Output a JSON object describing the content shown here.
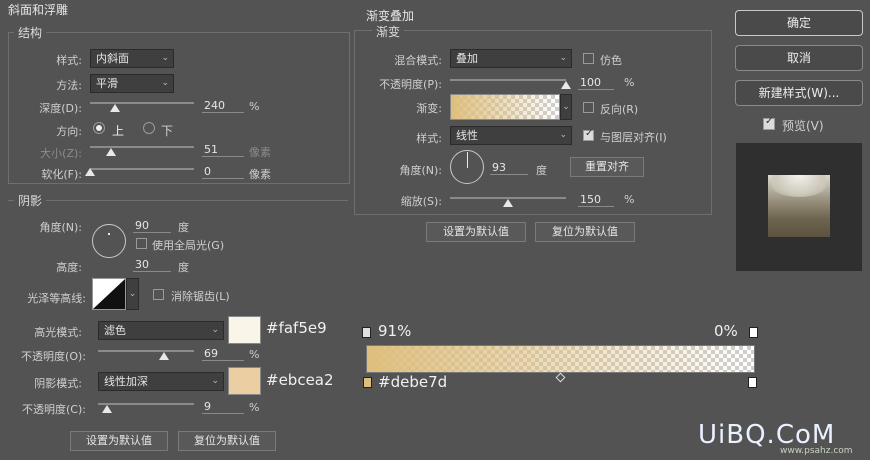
{
  "bevel": {
    "section_title": "斜面和浮雕",
    "structure_title": "结构",
    "style_label": "样式:",
    "style_value": "内斜面",
    "technique_label": "方法:",
    "technique_value": "平滑",
    "depth_label": "深度(D):",
    "depth_value": "240",
    "depth_unit": "%",
    "depth_level": 0.24,
    "direction_label": "方向:",
    "dir_up": "上",
    "dir_down": "下",
    "size_label": "大小(Z):",
    "size_value": "51",
    "size_unit": "像素",
    "size_level": 0.2,
    "soften_label": "软化(F):",
    "soften_value": "0",
    "soften_unit": "像素",
    "soften_level": 0.0
  },
  "shading": {
    "title": "阴影",
    "angle_label": "角度(N):",
    "angle_value": "90",
    "angle_unit": "度",
    "global_light_label": "使用全局光(G)",
    "altitude_label": "高度:",
    "altitude_value": "30",
    "altitude_unit": "度",
    "gloss_label": "光泽等高线:",
    "anti_alias_label": "消除锯齿(L)",
    "highlight_label": "高光模式:",
    "highlight_value": "滤色",
    "highlight_hex": "#faf5e9",
    "highlight_color": "#faf5e9",
    "hl_opacity_label": "不透明度(O):",
    "hl_opacity_value": "69",
    "hl_opacity_unit": "%",
    "hl_opacity_level": 0.69,
    "shadow_label": "阴影模式:",
    "shadow_value": "线性加深",
    "shadow_hex": "#ebcea2",
    "shadow_color": "#ebcea2",
    "sh_opacity_label": "不透明度(C):",
    "sh_opacity_value": "9",
    "sh_opacity_unit": "%",
    "sh_opacity_level": 0.09
  },
  "bottom_buttons": {
    "make_default": "设置为默认值",
    "reset_default": "复位为默认值"
  },
  "gradient_overlay": {
    "section_title": "渐变叠加",
    "sub_title": "渐变",
    "blend_label": "混合模式:",
    "blend_value": "叠加",
    "dither_label": "仿色",
    "opacity_label": "不透明度(P):",
    "opacity_value": "100",
    "opacity_unit": "%",
    "opacity_level": 1.0,
    "gradient_label": "渐变:",
    "reverse_label": "反向(R)",
    "style_label": "样式:",
    "style_value": "线性",
    "align_label": "与图层对齐(I)",
    "angle_label": "角度(N):",
    "angle_value": "93",
    "angle_unit": "度",
    "reset_align": "重置对齐",
    "scale_label": "缩放(S):",
    "scale_value": "150",
    "scale_unit": "%",
    "scale_level": 0.5,
    "make_default": "设置为默认值",
    "reset_default": "复位为默认值"
  },
  "side_buttons": {
    "ok": "确定",
    "cancel": "取消",
    "new_style": "新建样式(W)...",
    "preview_label": "预览(V)"
  },
  "gradient_editor": {
    "left_opacity": "91%",
    "right_opacity": "0%",
    "stop_hex": "#debe7d",
    "stop_color": "#debe7d"
  },
  "watermark": {
    "text": "UiBQ.CoM",
    "url": "www.psahz.com"
  }
}
